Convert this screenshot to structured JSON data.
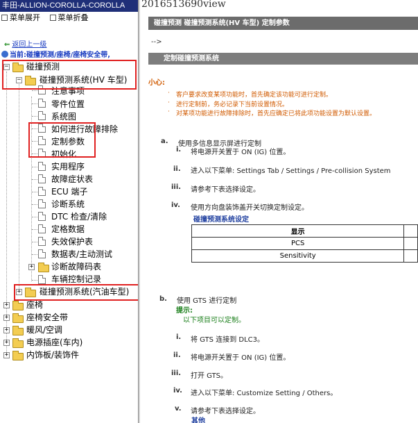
{
  "left": {
    "window_title": "丰田-ALLION-COROLLA-COROLLA",
    "toolbar": {
      "expand": "菜单展开",
      "collapse": "菜单折叠"
    },
    "back_link": "返回上一级",
    "current_location": "当前:碰撞预测/座椅/座椅安全带,",
    "tree": {
      "root": "碰撞预测",
      "hv_system": "碰撞预测系统(HV 车型)",
      "hv_children": [
        "注意事项",
        "零件位置",
        "系统图",
        "如何进行故障排除",
        "定制参数",
        "初始化",
        "实用程序",
        "故障症状表",
        "ECU 端子",
        "诊断系统",
        "DTC 检查/清除",
        "定格数据",
        "失效保护表",
        "数据表/主动测试",
        "诊断故障码表",
        "车辆控制记录"
      ],
      "gas_system": "碰撞预测系统(汽油车型)",
      "top_items": [
        "座椅",
        "座椅安全带",
        "暖风/空调",
        "电源插座(车内)",
        "内饰板/装饰件"
      ]
    }
  },
  "right": {
    "page_id": "2016513690view",
    "header": "碰撞预测  碰撞预测系统(HV 车型)  定制参数",
    "arrow_text": "-->",
    "section_title": "定制碰撞预测系统",
    "hint_label": "小心:",
    "cautions": [
      "客户要求改变某项功能时，首先确定该功能可进行定制。",
      "进行定制前，务必记录下当前设置情况。",
      "对某项功能进行故障排除时，首先应确定已将此项功能设置为默认设置。"
    ],
    "steps_a": {
      "label": "a.",
      "text": "使用多信息显示屏进行定制",
      "items": [
        {
          "num": "i.",
          "text": "将电源开关置于 ON (IG) 位置。"
        },
        {
          "num": "ii.",
          "text": "进入以下菜单: Settings Tab / Settings / Pre-collision System"
        },
        {
          "num": "iii.",
          "text": "请参考下表选择设定。"
        },
        {
          "num": "iv.",
          "text": "使用方向盘装饰盖开关切换定制设定。"
        }
      ],
      "table_caption": "碰撞预测系统设定",
      "table_header": "显示",
      "table_rows": [
        "PCS",
        "Sensitivity"
      ]
    },
    "steps_b": {
      "label": "b.",
      "text": "使用 GTS 进行定制",
      "hint": "提示:",
      "hint_text": "以下项目可以定制。",
      "items": [
        {
          "num": "i.",
          "text": "将 GTS 连接到 DLC3。"
        },
        {
          "num": "ii.",
          "text": "将电源开关置于 ON (IG) 位置。"
        },
        {
          "num": "iii.",
          "text": "打开 GTS。"
        },
        {
          "num": "iv.",
          "text": "进入以下菜单: Customize Setting / Others。"
        },
        {
          "num": "v.",
          "text": "请参考下表选择设定。"
        }
      ],
      "other": "其他"
    }
  },
  "colors": {
    "title_bar": "#1f2f78",
    "header_bar": "#6c6c6c",
    "highlight": "#e02020",
    "caution": "#d05a00",
    "link": "#1a3cc1"
  }
}
